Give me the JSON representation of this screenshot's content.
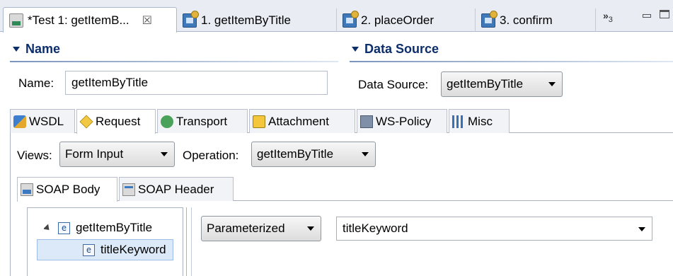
{
  "editor_tabs": [
    {
      "label": "*Test 1: getItemB...",
      "close": "☒",
      "icon": "soap-test-icon",
      "active": true
    },
    {
      "label": "1. getItemByTitle",
      "icon": "operation-icon"
    },
    {
      "label": "2. placeOrder",
      "icon": "operation-icon"
    },
    {
      "label": "3. confirm",
      "icon": "operation-icon"
    }
  ],
  "tab_overflow": {
    "glyph": "»",
    "count": "3"
  },
  "name_section": {
    "title": "Name",
    "label": "Name:",
    "value": "getItemByTitle"
  },
  "datasource_section": {
    "title": "Data Source",
    "label": "Data Source:",
    "value": "getItemByTitle"
  },
  "config_tabs": [
    {
      "label": "WSDL",
      "icon": "wsdl-icon"
    },
    {
      "label": "Request",
      "icon": "request-icon",
      "active": true
    },
    {
      "label": "Transport",
      "icon": "transport-icon"
    },
    {
      "label": "Attachment",
      "icon": "attachment-icon"
    },
    {
      "label": "WS-Policy",
      "icon": "ws-policy-icon"
    },
    {
      "label": "Misc",
      "icon": "misc-icon"
    }
  ],
  "request": {
    "views_label": "Views:",
    "views_value": "Form Input",
    "operation_label": "Operation:",
    "operation_value": "getItemByTitle"
  },
  "soap_tabs": [
    {
      "label": "SOAP Body",
      "icon": "soap-body-icon",
      "active": true
    },
    {
      "label": "SOAP Header",
      "icon": "soap-header-icon"
    }
  ],
  "tree": [
    {
      "label": "getItemByTitle",
      "type_glyph": "e",
      "expanded": true
    },
    {
      "label": "titleKeyword",
      "type_glyph": "e",
      "selected": true
    }
  ],
  "value_editor": {
    "mode": "Parameterized",
    "value": "titleKeyword"
  }
}
